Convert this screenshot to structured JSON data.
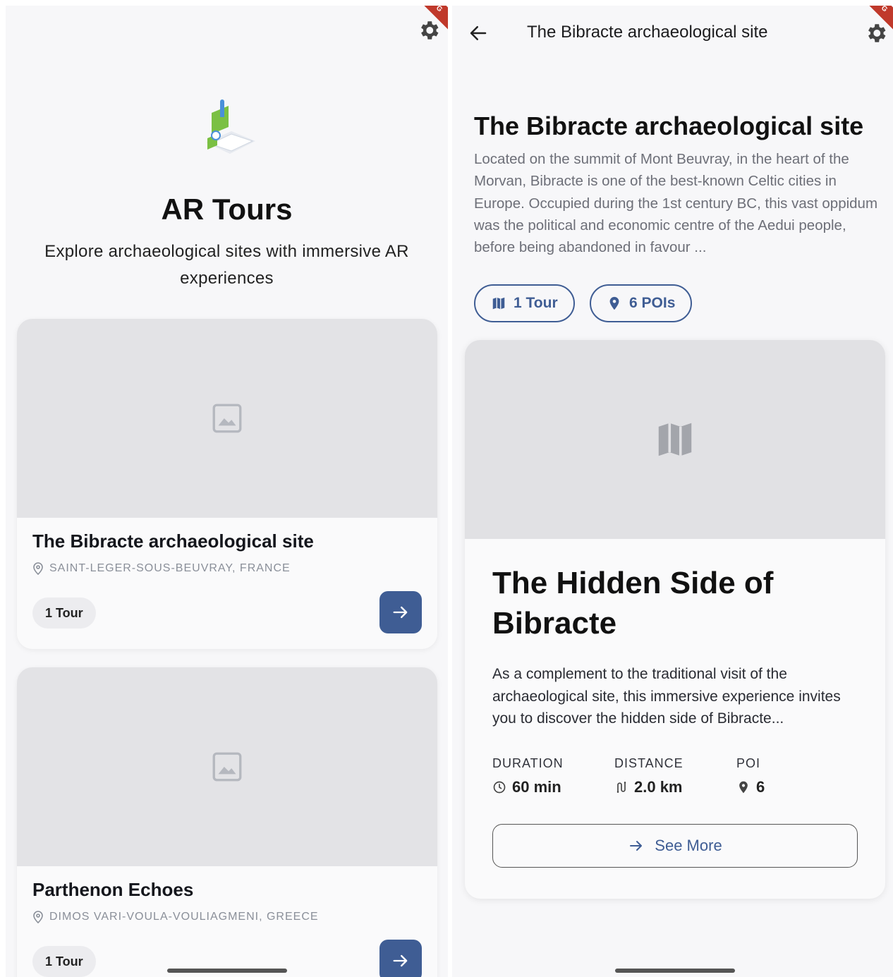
{
  "left": {
    "debug_label": "G",
    "app_title": "AR Tours",
    "app_subtitle": "Explore archaeological sites with immersive AR experiences",
    "sites": [
      {
        "name": "The Bibracte archaeological site",
        "location": "SAINT-LEGER-SOUS-BEUVRAY, FRANCE",
        "tours": "1 Tour"
      },
      {
        "name": "Parthenon Echoes",
        "location": "DIMOS VARI-VOULA-VOULIAGMENI, GREECE",
        "tours": "1 Tour"
      }
    ]
  },
  "right": {
    "debug_label": "G",
    "appbar_title": "The Bibracte archaeological site",
    "title": "The Bibracte archaeological site",
    "description": "Located on the summit of Mont Beuvray, in the heart of the Morvan, Bibracte is one of the best-known Celtic cities in Europe. Occupied during the 1st century BC, this vast oppidum was the political and economic centre of the Aedui people, before being abandoned in favour ...",
    "chips": {
      "tours": "1 Tour",
      "pois": "6 POIs"
    },
    "tour": {
      "title": "The Hidden Side of Bibracte",
      "description": "As a complement to the traditional visit of the archaeological site, this immersive experience invites you to discover the hidden side of Bibracte...",
      "stats": {
        "duration_label": "DURATION",
        "duration_value": "60 min",
        "distance_label": "DISTANCE",
        "distance_value": "2.0 km",
        "poi_label": "POI",
        "poi_value": "6"
      },
      "see_more": "See More"
    }
  },
  "colors": {
    "accent": "#3f5d94",
    "background": "#f7f7f9",
    "placeholder": "#e3e3e6"
  },
  "icons": [
    "gear-icon",
    "back-arrow-icon",
    "image-placeholder-icon",
    "location-pin-icon",
    "arrow-right-icon",
    "map-icon",
    "clock-icon",
    "route-icon"
  ]
}
